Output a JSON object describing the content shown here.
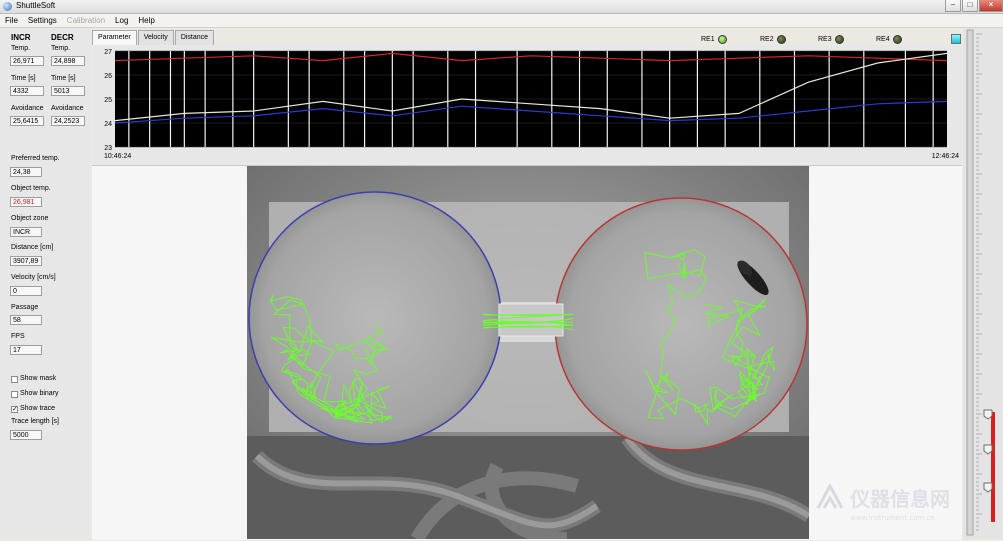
{
  "window": {
    "title": "ShuttleSoft",
    "controls": [
      "minimize",
      "maximize",
      "close"
    ]
  },
  "menu": [
    {
      "label": "File",
      "enabled": true
    },
    {
      "label": "Settings",
      "enabled": true
    },
    {
      "label": "Calibration",
      "enabled": false
    },
    {
      "label": "Log",
      "enabled": true
    },
    {
      "label": "Help",
      "enabled": true
    }
  ],
  "left_panel": {
    "incr_header": "INCR",
    "decr_header": "DECR",
    "temp_label": "Temp.",
    "incr_temp": "26,971",
    "decr_temp": "24,898",
    "time_label": "Time [s]",
    "incr_time": "4332",
    "decr_time": "5013",
    "avoidance_label": "Avoidance",
    "incr_avoidance": "25,6415",
    "decr_avoidance": "24,2523",
    "preferred_temp_label": "Preferred temp.",
    "preferred_temp": "24,38",
    "object_temp_label": "Object temp.",
    "object_temp": "26,981",
    "object_zone_label": "Object zone",
    "object_zone": "INCR",
    "distance_label": "Distance [cm]",
    "distance": "3907,89",
    "velocity_label": "Velocity [cm/s]",
    "velocity": "0",
    "passage_label": "Passage",
    "passage": "58",
    "fps_label": "FPS",
    "fps": "17",
    "show_mask_label": "Show mask",
    "show_mask": false,
    "show_binary_label": "Show binary",
    "show_binary": false,
    "show_trace_label": "Show trace",
    "show_trace": true,
    "trace_length_label": "Trace length [s]",
    "trace_length": "5000"
  },
  "tabs": [
    {
      "label": "Parameter",
      "active": true
    },
    {
      "label": "Velocity",
      "active": false
    },
    {
      "label": "Distance",
      "active": false
    }
  ],
  "indicators": [
    {
      "label": "RE1",
      "on": true
    },
    {
      "label": "RE2",
      "on": false
    },
    {
      "label": "RE3",
      "on": false
    },
    {
      "label": "RE4",
      "on": false
    }
  ],
  "chart_data": {
    "type": "line",
    "title": "",
    "xlabel": "",
    "ylabel": "",
    "x_tick_labels": [
      "10:46:24",
      "12:46:24"
    ],
    "y_tick_labels": [
      "23",
      "24",
      "25",
      "26",
      "27"
    ],
    "ylim": [
      23,
      27
    ],
    "grid": true,
    "background": "#000000",
    "x": [
      0,
      10,
      20,
      30,
      40,
      50,
      60,
      70,
      80,
      90,
      100,
      110,
      120
    ],
    "series": [
      {
        "color": "#d12a2a",
        "values": [
          26.6,
          26.7,
          26.8,
          26.6,
          26.9,
          26.6,
          26.8,
          26.7,
          26.6,
          26.7,
          26.8,
          26.7,
          26.6
        ]
      },
      {
        "color": "#e8e8d8",
        "values": [
          24.1,
          24.4,
          24.5,
          24.9,
          24.5,
          25.0,
          24.8,
          24.6,
          24.2,
          24.4,
          25.7,
          26.5,
          26.9
        ]
      },
      {
        "color": "#2a3bd1",
        "values": [
          24.0,
          24.2,
          24.3,
          24.6,
          24.3,
          24.7,
          24.5,
          24.3,
          24.1,
          24.2,
          24.5,
          24.8,
          24.9
        ]
      }
    ],
    "spike_x": [
      2,
      5,
      8,
      10,
      13,
      17,
      20,
      25,
      28,
      33,
      36,
      40,
      43,
      48,
      52,
      58,
      63,
      67,
      71,
      76,
      80,
      84,
      88,
      93,
      98,
      103,
      108,
      114,
      118
    ]
  },
  "camera_view": {
    "left_arena_color": "#3a3fb0",
    "right_arena_color": "#b83535",
    "trace_color": "#6dfa30"
  },
  "watermark": {
    "text": "仪器信息网",
    "sub": "www.instrument.com.cn"
  }
}
